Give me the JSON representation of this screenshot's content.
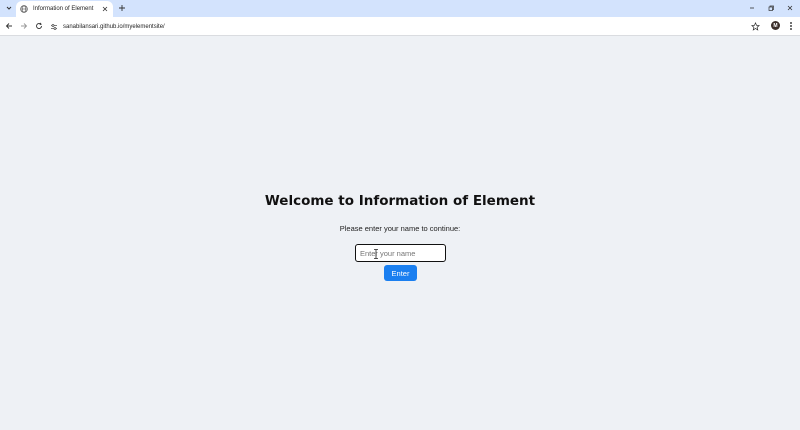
{
  "browser": {
    "tab": {
      "title": "Information of Element"
    },
    "url": "sanabilansari.github.io/myelementsite/",
    "profile_initial": "M"
  },
  "page": {
    "heading": "Welcome to Information of Element",
    "prompt": "Please enter your name to continue:",
    "name_input": {
      "placeholder": "Enter your name",
      "value": ""
    },
    "enter_button": "Enter"
  },
  "colors": {
    "tabstrip": "#d3e3fd",
    "page_background": "#eef1f5",
    "button_primary": "#1a7ff0"
  }
}
